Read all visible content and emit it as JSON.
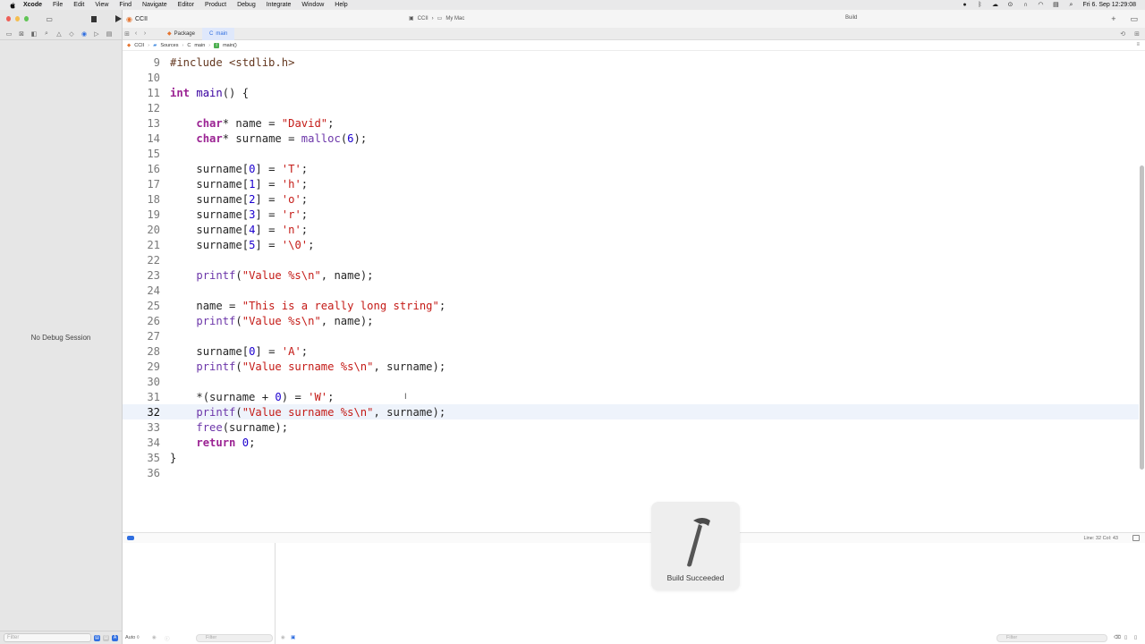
{
  "menubar": {
    "app": "Xcode",
    "items": [
      "File",
      "Edit",
      "View",
      "Find",
      "Navigate",
      "Editor",
      "Product",
      "Debug",
      "Integrate",
      "Window",
      "Help"
    ],
    "clock": "Fri 6. Sep  12:29:08"
  },
  "toolbar": {
    "scheme": "CCII",
    "destination_project": "CCII",
    "destination_device": "My Mac",
    "status": "Build"
  },
  "tabs": [
    {
      "label": "Package",
      "icon": "package-icon"
    },
    {
      "label": "main",
      "icon": "c-file-icon",
      "active": true
    }
  ],
  "jumpbar": {
    "items": [
      "CCII",
      "Sources",
      "main",
      "main()"
    ]
  },
  "editor": {
    "lines": [
      {
        "n": "9"
      },
      {
        "n": "10"
      },
      {
        "n": "11"
      },
      {
        "n": "12"
      },
      {
        "n": "13"
      },
      {
        "n": "14"
      },
      {
        "n": "15"
      },
      {
        "n": "16"
      },
      {
        "n": "17"
      },
      {
        "n": "18"
      },
      {
        "n": "19"
      },
      {
        "n": "20"
      },
      {
        "n": "21"
      },
      {
        "n": "22"
      },
      {
        "n": "23"
      },
      {
        "n": "24"
      },
      {
        "n": "25"
      },
      {
        "n": "26"
      },
      {
        "n": "27"
      },
      {
        "n": "28"
      },
      {
        "n": "29"
      },
      {
        "n": "30"
      },
      {
        "n": "31"
      },
      {
        "n": "32"
      },
      {
        "n": "33"
      },
      {
        "n": "34"
      },
      {
        "n": "35"
      },
      {
        "n": "36"
      }
    ],
    "code": {
      "l9": "#include <stdlib.h>",
      "l11_kw": "int",
      "l11_fn": "main",
      "l11_rest": "() {",
      "l13_kw": "char",
      "l13_rest": "* name = ",
      "l13_str": "\"David\"",
      "l13_end": ";",
      "l14_kw": "char",
      "l14_rest": "* surname = ",
      "l14_fn": "malloc",
      "l14_open": "(",
      "l14_num": "6",
      "l14_end": ");",
      "l16_a": "surname[",
      "l16_n": "0",
      "l16_b": "] = ",
      "l16_s": "'T'",
      "l17_n": "1",
      "l17_s": "'h'",
      "l18_n": "2",
      "l18_s": "'o'",
      "l19_n": "3",
      "l19_s": "'r'",
      "l20_n": "4",
      "l20_s": "'n'",
      "l21_n": "5",
      "l21_s": "'\\0'",
      "printf": "printf",
      "l23_s": "\"Value %s\\n\"",
      "l23_rest": ", name);",
      "l25_a": "name = ",
      "l25_s": "\"This is a really long string\"",
      "l28_n": "0",
      "l28_s": "'A'",
      "l29_s": "\"Value surname %s\\n\"",
      "l29_rest": ", surname);",
      "l31_a": "*(surname + ",
      "l31_n": "0",
      "l31_b": ") = ",
      "l31_s": "'W'",
      "l33_fn": "free",
      "l33_rest": "(surname);",
      "l34_kw": "return",
      "l34_n": "0",
      "semicolon": ";",
      "bracket_open": "(",
      "close_brace": "}"
    },
    "current_line": "32"
  },
  "status": {
    "line_col": "Line: 32  Col: 43"
  },
  "sidebar": {
    "no_debug": "No Debug Session",
    "filter_placeholder": "Filter"
  },
  "debug_footer": {
    "auto": "Auto ◊",
    "filter_placeholder": "Filter"
  },
  "hud": {
    "label": "Build Succeeded"
  },
  "colors": {
    "keyword": "#9b2393",
    "string": "#c41a16",
    "number": "#1c00cf",
    "accent": "#2f6ee0"
  }
}
